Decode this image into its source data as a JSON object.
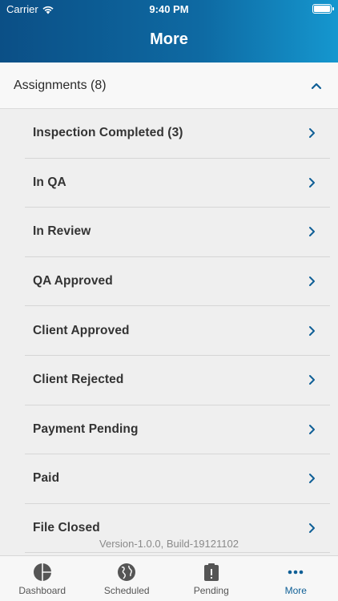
{
  "status_bar": {
    "carrier": "Carrier",
    "time": "9:40 PM"
  },
  "nav": {
    "title": "More"
  },
  "section": {
    "title": "Assignments (8)"
  },
  "items": [
    {
      "label": "Inspection Completed (3)"
    },
    {
      "label": "In QA"
    },
    {
      "label": "In Review"
    },
    {
      "label": "QA Approved"
    },
    {
      "label": "Client Approved"
    },
    {
      "label": "Client Rejected"
    },
    {
      "label": "Payment Pending"
    },
    {
      "label": "Paid"
    },
    {
      "label": "File Closed"
    }
  ],
  "footer": {
    "version": "Version-1.0.0, Build-19121102"
  },
  "tabs": [
    {
      "label": "Dashboard",
      "icon": "pie-chart-icon"
    },
    {
      "label": "Scheduled",
      "icon": "globe-icon"
    },
    {
      "label": "Pending",
      "icon": "clipboard-alert-icon"
    },
    {
      "label": "More",
      "icon": "more-dots-icon",
      "active": true
    }
  ],
  "colors": {
    "accent": "#0f5f96",
    "header_start": "#0b4f86",
    "header_end": "#1597cf"
  }
}
